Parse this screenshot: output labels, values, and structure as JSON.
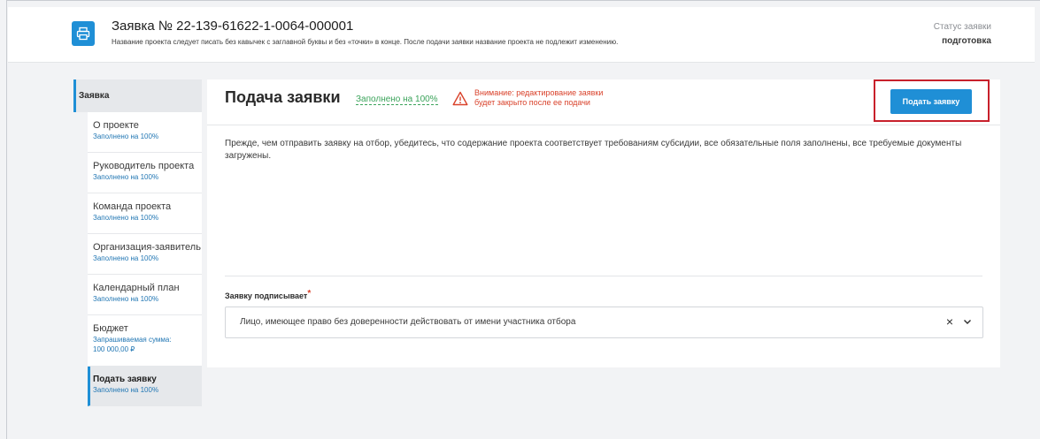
{
  "header": {
    "title": "Заявка № 22-139-61622-1-0064-000001",
    "subtitle": "Название проекта следует писать без кавычек с заглавной буквы и без «точки» в конце. После подачи заявки название проекта не подлежит изменению.",
    "status_label": "Статус заявки",
    "status_value": "подготовка",
    "icon": "printer-icon"
  },
  "sidebar": {
    "head": "Заявка",
    "items": [
      {
        "label": "О проекте",
        "sub": "Заполнено на 100%"
      },
      {
        "label": "Руководитель проекта",
        "sub": "Заполнено на 100%"
      },
      {
        "label": "Команда проекта",
        "sub": "Заполнено на 100%"
      },
      {
        "label": "Организация-заявитель",
        "sub": "Заполнено на 100%"
      },
      {
        "label": "Календарный план",
        "sub": "Заполнено на 100%"
      },
      {
        "label": "Бюджет",
        "sub": "Запрашиваемая сумма:",
        "sub2": "100 000,00 ₽"
      },
      {
        "label": "Подать заявку",
        "sub": "Заполнено на 100%",
        "active": true
      }
    ]
  },
  "main": {
    "title": "Подача заявки",
    "fill_status": "Заполнено на 100%",
    "warning_line1": "Внимание: редактирование заявки",
    "warning_line2": "будет закрыто после ее подачи",
    "submit_label": "Подать заявку",
    "description": "Прежде, чем отправить заявку на отбор, убедитесь, что содержание проекта соответствует требованиям субсидии, все обязательные поля заполнены, все требуемые документы загружены.",
    "signer_label": "Заявку подписывает",
    "required_mark": "*",
    "signer_value": "Лицо, имеющее право без доверенности действовать от имени участника отбора",
    "clear_glyph": "×"
  },
  "colors": {
    "accent": "#1f8fd6",
    "success": "#3aa35a",
    "warning": "#d9422b",
    "highlight_border": "#c8202b"
  }
}
